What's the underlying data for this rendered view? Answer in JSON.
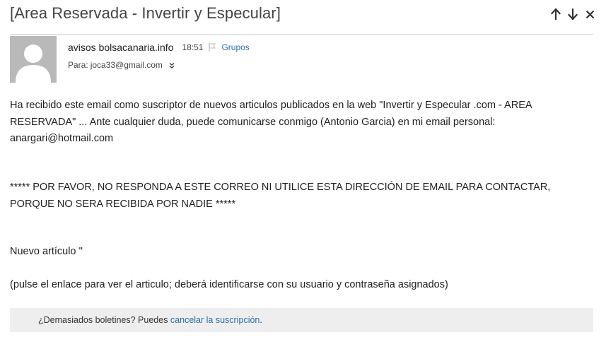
{
  "message": {
    "subject": "[Area Reservada - Invertir y Especular]",
    "sender_name": "avisos bolsacanaria.info",
    "time": "18:51",
    "folder_link": "Grupos",
    "to_label": "Para:",
    "to_address": "joca33@gmail.com"
  },
  "actions": {
    "prev_icon": "arrow-up-icon",
    "next_icon": "arrow-down-icon",
    "close_icon": "close-icon"
  },
  "body": {
    "paragraph1": "Ha recibido este email como suscriptor de nuevos articulos publicados en la web \"Invertir y Especular .com - AREA RESERVADA\" ... Ante cualquier duda, puede comunicarse conmigo (Antonio Garcia) en mi email personal: anargari@hotmail.com",
    "paragraph2": "***** POR FAVOR, NO RESPONDA A ESTE CORREO NI UTILICE ESTA DIRECCIÓN DE EMAIL PARA CONTACTAR, PORQUE NO SERA RECIBIDA POR NADIE *****",
    "paragraph3": "Nuevo artículo ''",
    "paragraph4": "(pulse el enlace para ver el articulo; deberá identificarse con su usuario y contraseña asignados)"
  },
  "footer": {
    "prompt": "¿Demasiados boletines? Puedes ",
    "link": "cancelar la suscripción",
    "suffix": "."
  },
  "colors": {
    "link": "#2a6ead",
    "avatar_bg": "#b9b9b9",
    "footer_bg": "#eeeeee"
  }
}
